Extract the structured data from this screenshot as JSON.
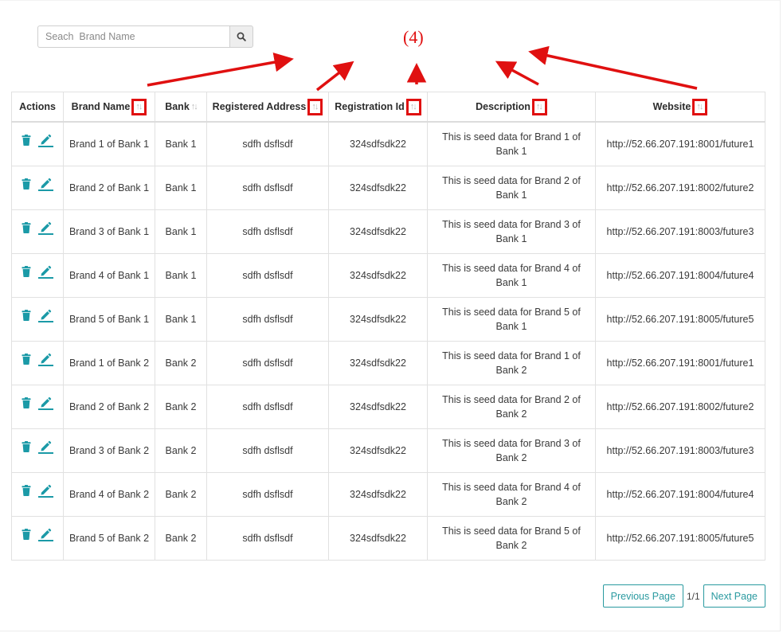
{
  "search": {
    "placeholder": "Seach  Brand Name"
  },
  "annotation": {
    "label": "(4)"
  },
  "table": {
    "headers": [
      {
        "label": "Actions",
        "sortable": false
      },
      {
        "label": "Brand Name",
        "sortable": true,
        "highlighted": true
      },
      {
        "label": "Bank",
        "sortable": true,
        "highlighted": false
      },
      {
        "label": "Registered Address",
        "sortable": true,
        "highlighted": true
      },
      {
        "label": "Registration Id",
        "sortable": true,
        "highlighted": true
      },
      {
        "label": "Description",
        "sortable": true,
        "highlighted": true
      },
      {
        "label": "Website",
        "sortable": true,
        "highlighted": true
      }
    ],
    "sort_glyph": "↑↓",
    "rows": [
      {
        "brand": "Brand 1 of Bank 1",
        "bank": "Bank 1",
        "address": "sdfh dsflsdf",
        "reg_id": "324sdfsdk22",
        "description": "This is seed data for Brand 1 of Bank 1",
        "website": "http://52.66.207.191:8001/future1"
      },
      {
        "brand": "Brand 2 of Bank 1",
        "bank": "Bank 1",
        "address": "sdfh dsflsdf",
        "reg_id": "324sdfsdk22",
        "description": "This is seed data for Brand 2 of Bank 1",
        "website": "http://52.66.207.191:8002/future2"
      },
      {
        "brand": "Brand 3 of Bank 1",
        "bank": "Bank 1",
        "address": "sdfh dsflsdf",
        "reg_id": "324sdfsdk22",
        "description": "This is seed data for Brand 3 of Bank 1",
        "website": "http://52.66.207.191:8003/future3"
      },
      {
        "brand": "Brand 4 of Bank 1",
        "bank": "Bank 1",
        "address": "sdfh dsflsdf",
        "reg_id": "324sdfsdk22",
        "description": "This is seed data for Brand 4 of Bank 1",
        "website": "http://52.66.207.191:8004/future4"
      },
      {
        "brand": "Brand 5 of Bank 1",
        "bank": "Bank 1",
        "address": "sdfh dsflsdf",
        "reg_id": "324sdfsdk22",
        "description": "This is seed data for Brand 5 of Bank 1",
        "website": "http://52.66.207.191:8005/future5"
      },
      {
        "brand": "Brand 1 of Bank 2",
        "bank": "Bank 2",
        "address": "sdfh dsflsdf",
        "reg_id": "324sdfsdk22",
        "description": "This is seed data for Brand 1 of Bank 2",
        "website": "http://52.66.207.191:8001/future1"
      },
      {
        "brand": "Brand 2 of Bank 2",
        "bank": "Bank 2",
        "address": "sdfh dsflsdf",
        "reg_id": "324sdfsdk22",
        "description": "This is seed data for Brand 2 of Bank 2",
        "website": "http://52.66.207.191:8002/future2"
      },
      {
        "brand": "Brand 3 of Bank 2",
        "bank": "Bank 2",
        "address": "sdfh dsflsdf",
        "reg_id": "324sdfsdk22",
        "description": "This is seed data for Brand 3 of Bank 2",
        "website": "http://52.66.207.191:8003/future3"
      },
      {
        "brand": "Brand 4 of Bank 2",
        "bank": "Bank 2",
        "address": "sdfh dsflsdf",
        "reg_id": "324sdfsdk22",
        "description": "This is seed data for Brand 4 of Bank 2",
        "website": "http://52.66.207.191:8004/future4"
      },
      {
        "brand": "Brand 5 of Bank 2",
        "bank": "Bank 2",
        "address": "sdfh dsflsdf",
        "reg_id": "324sdfsdk22",
        "description": "This is seed data for Brand 5 of Bank 2",
        "website": "http://52.66.207.191:8005/future5"
      }
    ]
  },
  "pagination": {
    "previous_label": "Previous Page",
    "page_indicator": "1/1",
    "next_label": "Next Page"
  },
  "colors": {
    "accent": "#2a9aa0",
    "annotation": "#e01010"
  },
  "icons": {
    "search": "search-icon",
    "delete": "trash-icon",
    "edit": "pencil-icon"
  }
}
